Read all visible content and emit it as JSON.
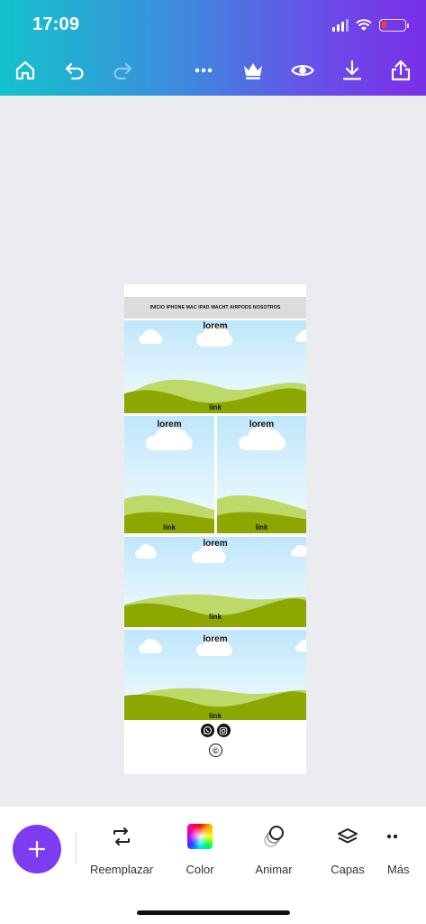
{
  "status_bar": {
    "time": "17:09"
  },
  "toolbar": {
    "icons": [
      "home-icon",
      "undo-icon",
      "redo-icon",
      "more-icon",
      "crown-icon",
      "preview-icon",
      "download-icon",
      "share-icon"
    ]
  },
  "design": {
    "nav_text": "INICIO  IPHONE  MAC  IPAD  WACHT  AIRPODS  NOSOTROS",
    "panels": [
      {
        "title": "lorem",
        "link": "link"
      },
      {
        "title": "lorem",
        "link": "link"
      },
      {
        "title": "lorem",
        "link": "link"
      },
      {
        "title": "lorem",
        "link": "link"
      },
      {
        "title": "lorem",
        "link": "link"
      }
    ],
    "copyright_symbol": "©"
  },
  "bottom_tools": [
    {
      "label": "Reemplazar",
      "icon": "replace-icon"
    },
    {
      "label": "Color",
      "icon": "color-icon"
    },
    {
      "label": "Animar",
      "icon": "animate-icon"
    },
    {
      "label": "Capas",
      "icon": "layers-icon"
    },
    {
      "label": "Más",
      "icon": "more-icon"
    }
  ],
  "colors": {
    "accent": "#7d3cf0",
    "hill_dark": "#8ca800",
    "hill_light": "#bcd96a"
  }
}
